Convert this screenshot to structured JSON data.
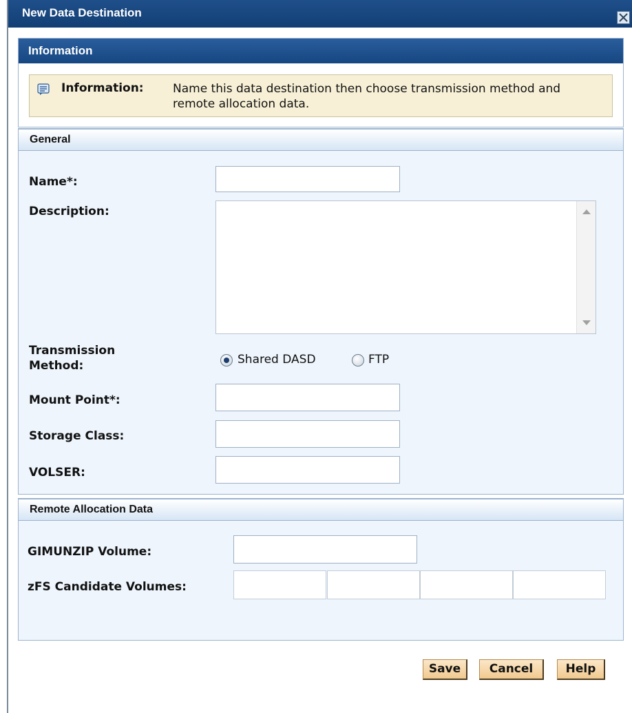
{
  "dialog": {
    "title": "New Data Destination",
    "close_icon": "close-icon"
  },
  "information": {
    "header": "Information",
    "label": "Information:",
    "text": "Name this data destination then choose transmission method and remote allocation data."
  },
  "general": {
    "header": "General",
    "name_label": "Name*:",
    "name_value": "",
    "description_label": "Description:",
    "description_value": "",
    "transmission_label": "Transmission Method:",
    "options": [
      {
        "label": "Shared DASD",
        "selected": true
      },
      {
        "label": "FTP",
        "selected": false
      }
    ],
    "mount_point_label": "Mount Point*:",
    "mount_point_value": "",
    "storage_class_label": "Storage Class:",
    "storage_class_value": "",
    "volser_label": "VOLSER:",
    "volser_value": ""
  },
  "remote": {
    "header": "Remote Allocation Data",
    "gimunzip_label": "GIMUNZIP Volume:",
    "gimunzip_value": "",
    "zfs_label": "zFS Candidate Volumes:",
    "zfs_values": [
      "",
      "",
      "",
      ""
    ]
  },
  "buttons": {
    "save": "Save",
    "cancel": "Cancel",
    "help": "Help"
  },
  "colors": {
    "title_bar": "#1f4f8a",
    "info_box": "#f7f0d6",
    "panel_bg": "#eef5fd",
    "button": "#f1c98f"
  }
}
